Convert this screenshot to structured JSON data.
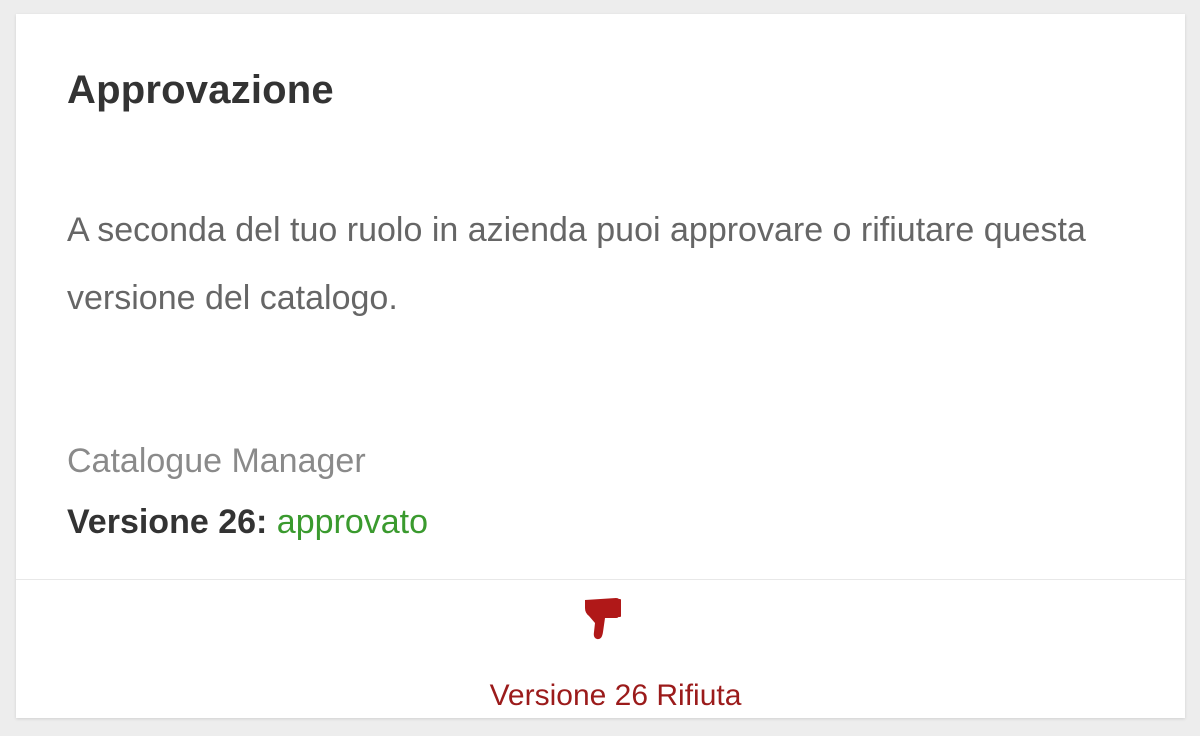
{
  "card": {
    "title": "Approvazione",
    "description": "A seconda del tuo ruolo in azienda puoi approvare o rifiutare questa versione del catalogo.",
    "role": "Catalogue Manager",
    "version_label": "Versione 26:",
    "version_status": "approvato"
  },
  "action": {
    "icon": "thumbs-down-icon",
    "label": "Versione 26 Rifiuta"
  },
  "colors": {
    "status_approved": "#3a9a2e",
    "reject_accent": "#9b1b1b"
  }
}
